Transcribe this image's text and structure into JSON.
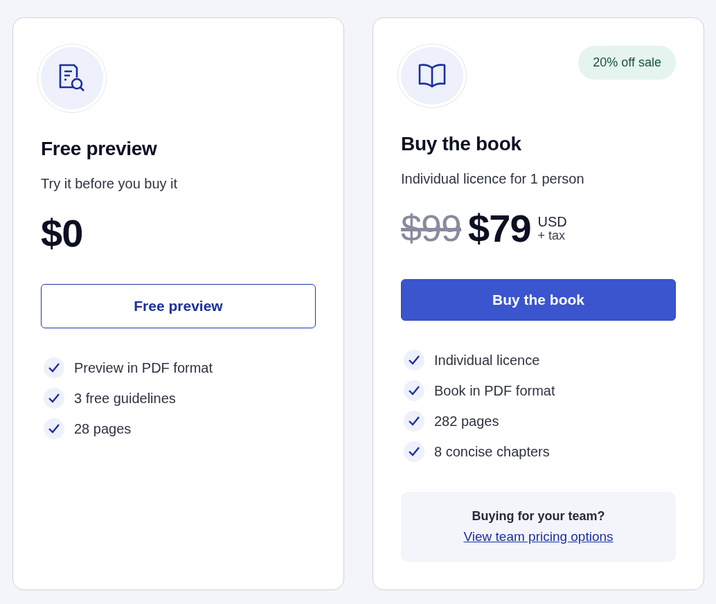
{
  "plans": [
    {
      "kind": "free",
      "title": "Free preview",
      "subtitle": "Try it before you buy it",
      "price": "$0",
      "button": "Free preview",
      "features": [
        {
          "text": "Preview in PDF format",
          "checked": true
        },
        {
          "text": "3 free guidelines",
          "checked": true
        },
        {
          "text": "28 pages",
          "checked": true
        }
      ]
    },
    {
      "kind": "paid",
      "badge": "20% off sale",
      "title": "Buy the book",
      "subtitle": "Individual licence for 1 person",
      "old_price": "$99",
      "price": "$79",
      "currency": "USD",
      "tax": "+ tax",
      "button": "Buy the book",
      "features": [
        {
          "text": "Individual licence",
          "checked": true
        },
        {
          "text": "Book in PDF format",
          "checked": true
        },
        {
          "text": "282 pages",
          "checked": true
        },
        {
          "text": "8 concise chapters",
          "checked": true
        }
      ],
      "team": {
        "question": "Buying for your team?",
        "link": "View team pricing options"
      }
    }
  ]
}
